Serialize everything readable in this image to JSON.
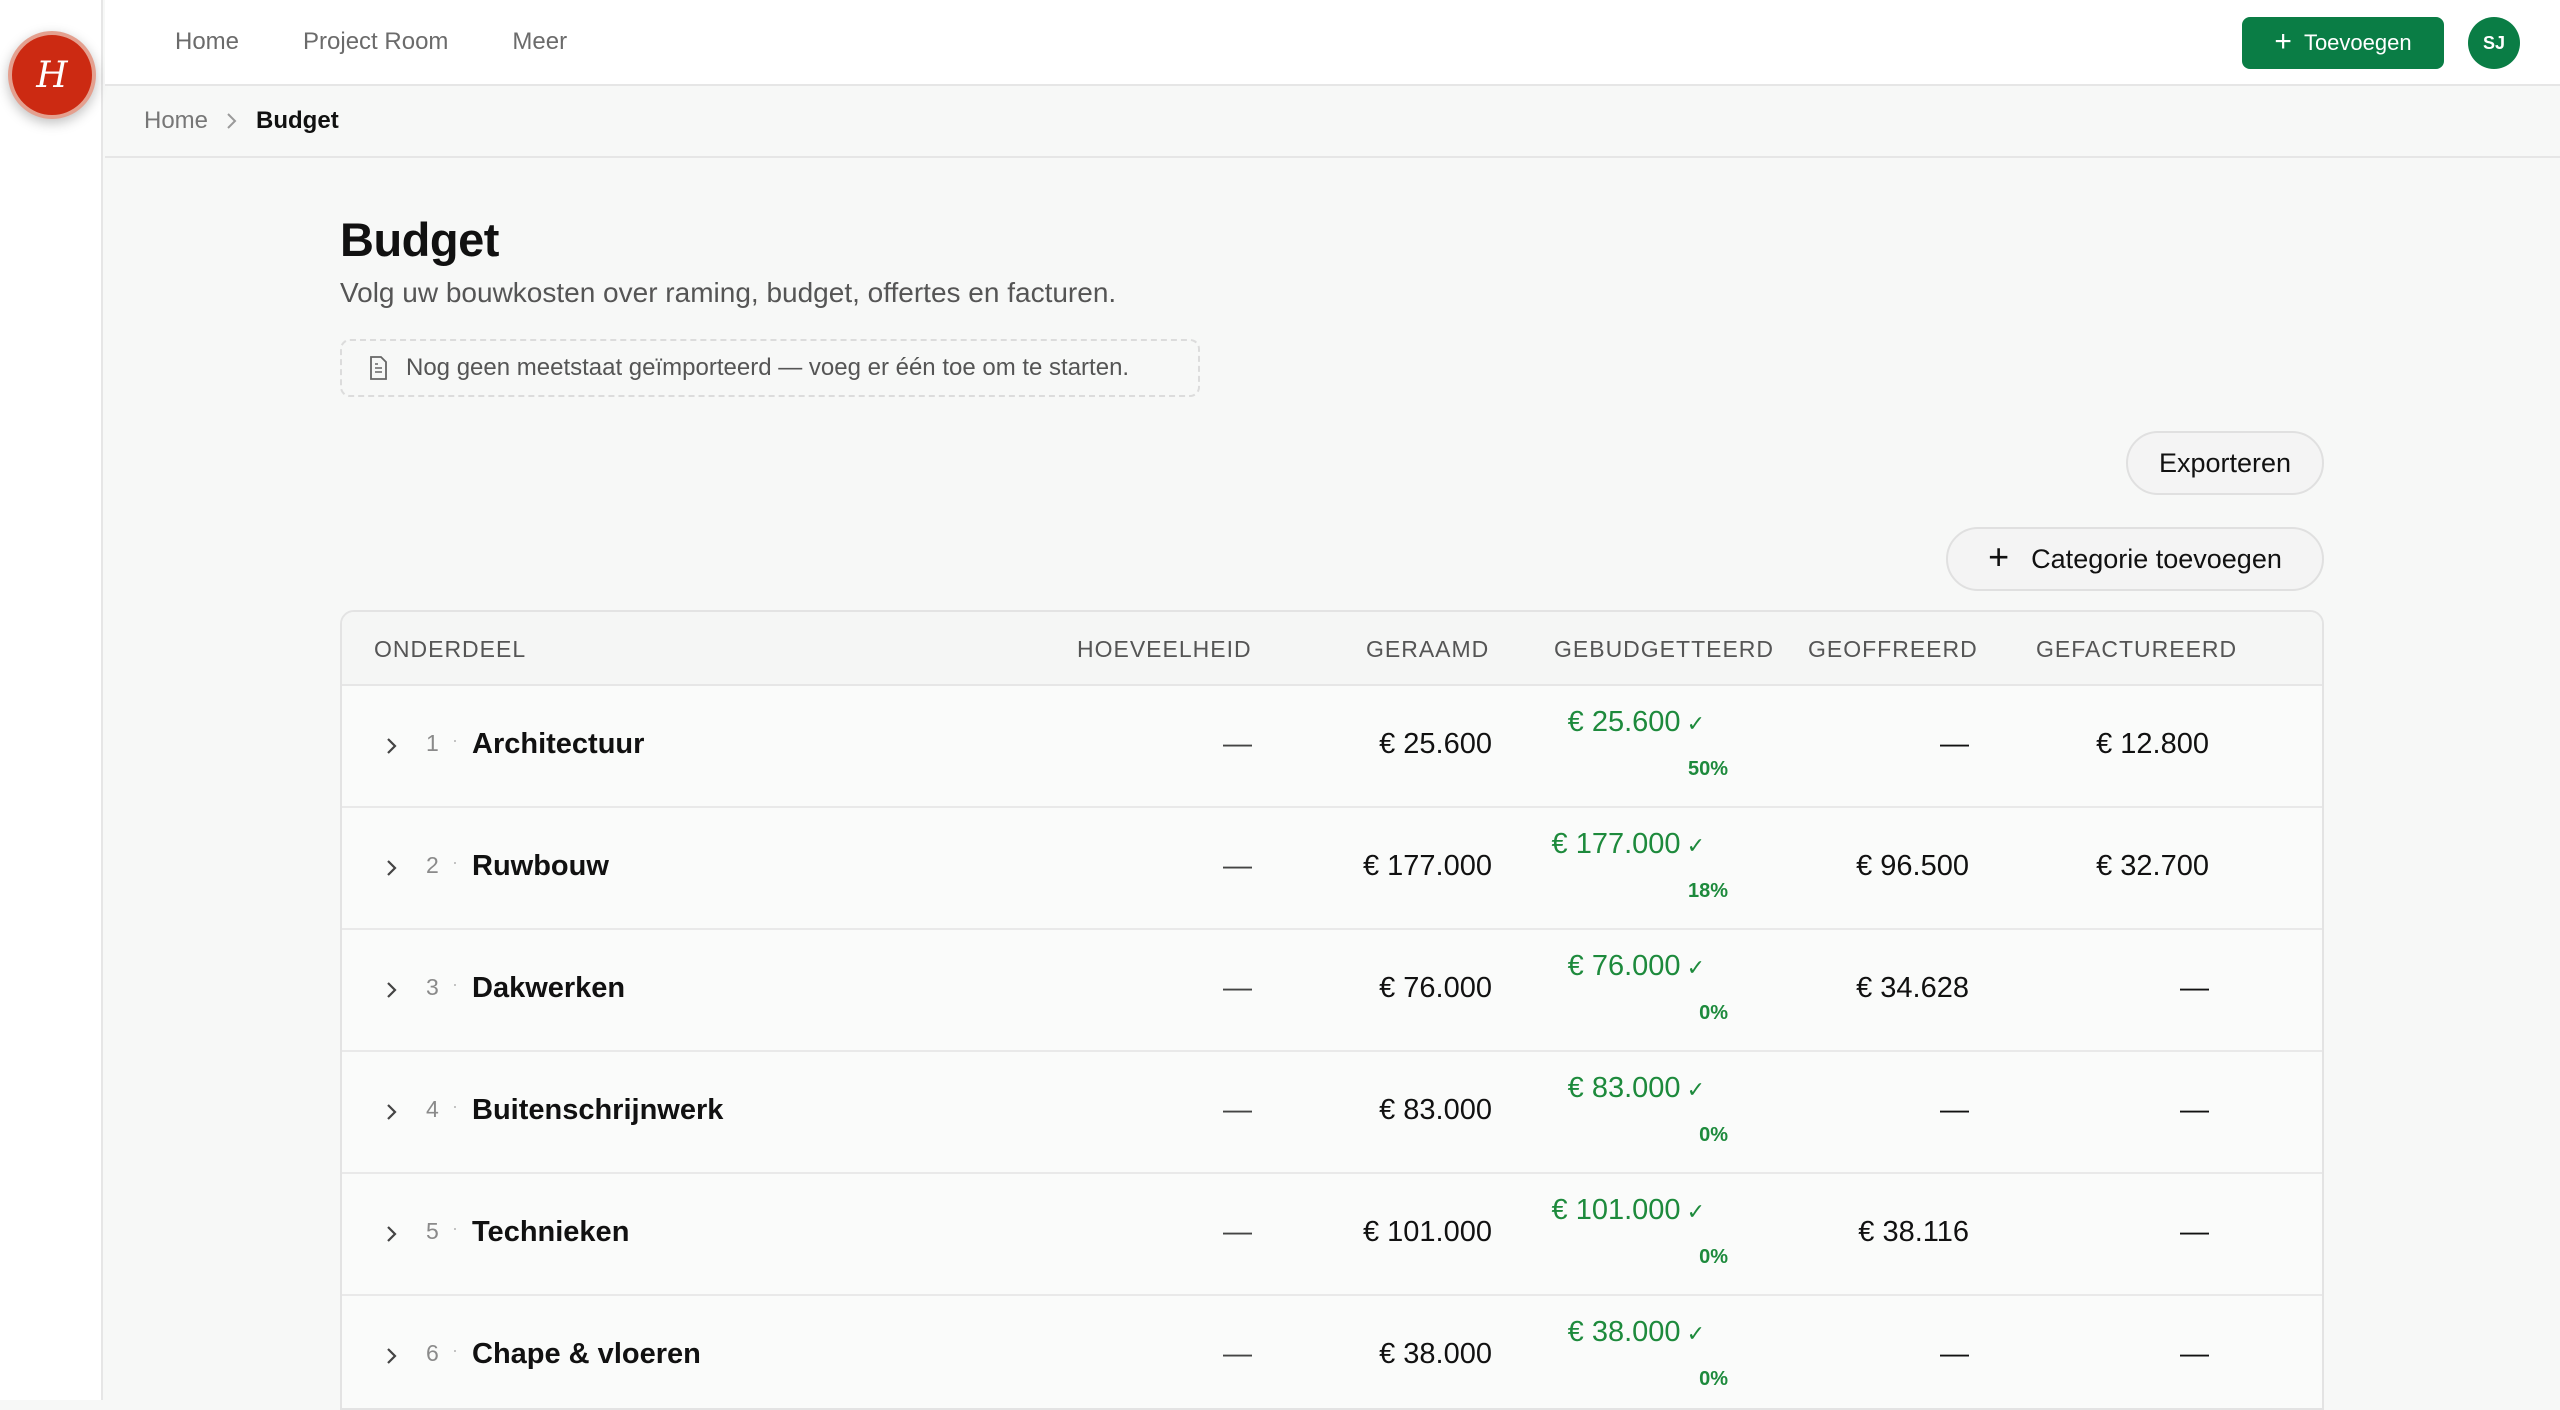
{
  "app": {
    "logo_letter": "H"
  },
  "topnav": {
    "items": [
      "Home",
      "Project Room",
      "Meer"
    ]
  },
  "header": {
    "add_label": "Toevoegen",
    "avatar_initials": "SJ"
  },
  "breadcrumb": {
    "home": "Home",
    "current": "Budget"
  },
  "page": {
    "title": "Budget",
    "subtitle": "Volg uw bouwkosten over raming, budget, offertes en facturen.",
    "notice": "Nog geen meetstaat geïmporteerd — voeg er één toe om te starten."
  },
  "actions": {
    "export_label": "Exporteren",
    "add_category_label": "Categorie toevoegen"
  },
  "table": {
    "columns": [
      "ONDERDEEL",
      "HOEVEELHEID",
      "GERAAMD",
      "GEBUDGETTEERD",
      "GEOFFREERD",
      "GEFACTUREERD"
    ],
    "rows": [
      {
        "num": "1",
        "name": "Architectuur",
        "qty": "—",
        "estimated": "€ 25.600",
        "budgeted": "€ 25.600",
        "pct": "50%",
        "offered": "—",
        "invoiced": "€ 12.800"
      },
      {
        "num": "2",
        "name": "Ruwbouw",
        "qty": "—",
        "estimated": "€ 177.000",
        "budgeted": "€ 177.000",
        "pct": "18%",
        "offered": "€ 96.500",
        "invoiced": "€ 32.700"
      },
      {
        "num": "3",
        "name": "Dakwerken",
        "qty": "—",
        "estimated": "€ 76.000",
        "budgeted": "€ 76.000",
        "pct": "0%",
        "offered": "€ 34.628",
        "invoiced": "—"
      },
      {
        "num": "4",
        "name": "Buitenschrijnwerk",
        "qty": "—",
        "estimated": "€ 83.000",
        "budgeted": "€ 83.000",
        "pct": "0%",
        "offered": "—",
        "invoiced": "—"
      },
      {
        "num": "5",
        "name": "Technieken",
        "qty": "—",
        "estimated": "€ 101.000",
        "budgeted": "€ 101.000",
        "pct": "0%",
        "offered": "€ 38.116",
        "invoiced": "—"
      },
      {
        "num": "6",
        "name": "Chape & vloeren",
        "qty": "—",
        "estimated": "€ 38.000",
        "budgeted": "€ 38.000",
        "pct": "0%",
        "offered": "—",
        "invoiced": "—"
      }
    ]
  },
  "colors": {
    "brand_green": "#0a7d45",
    "budget_green": "#1d8a3c",
    "logo_red": "#cc2a12"
  }
}
